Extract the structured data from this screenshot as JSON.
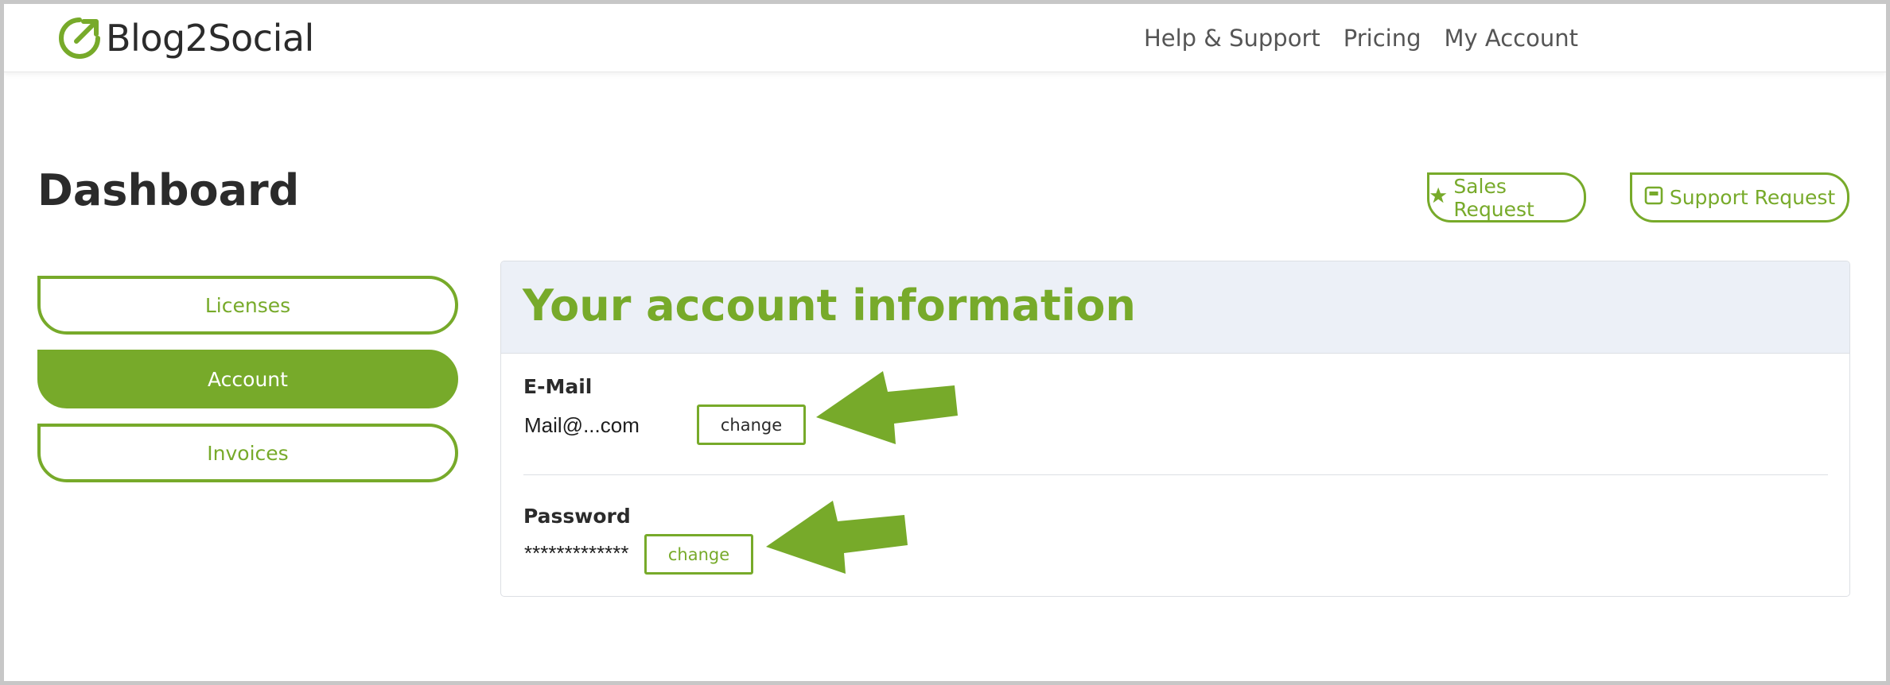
{
  "brand": {
    "name": "Blog2Social",
    "logo_icon": "arrow-up-right-circle-icon",
    "accent": "#77aa2a"
  },
  "topnav": {
    "items": [
      "Help & Support",
      "Pricing",
      "My Account"
    ]
  },
  "page": {
    "title": "Dashboard"
  },
  "requests": {
    "sales": {
      "label": "Sales Request",
      "icon": "star-icon"
    },
    "support": {
      "label": "Support Request",
      "icon": "support-icon"
    }
  },
  "sidebar": {
    "items": [
      {
        "label": "Licenses",
        "active": false
      },
      {
        "label": "Account",
        "active": true
      },
      {
        "label": "Invoices",
        "active": false
      }
    ]
  },
  "account": {
    "title": "Your account information",
    "email": {
      "label": "E-Mail",
      "value": "Mail@...com",
      "change_label": "change"
    },
    "password": {
      "label": "Password",
      "value": "*************",
      "change_label": "change"
    }
  },
  "colors": {
    "accent": "#77aa2a",
    "card_header_bg": "#ecf0f7",
    "text": "#2b2b2b"
  }
}
